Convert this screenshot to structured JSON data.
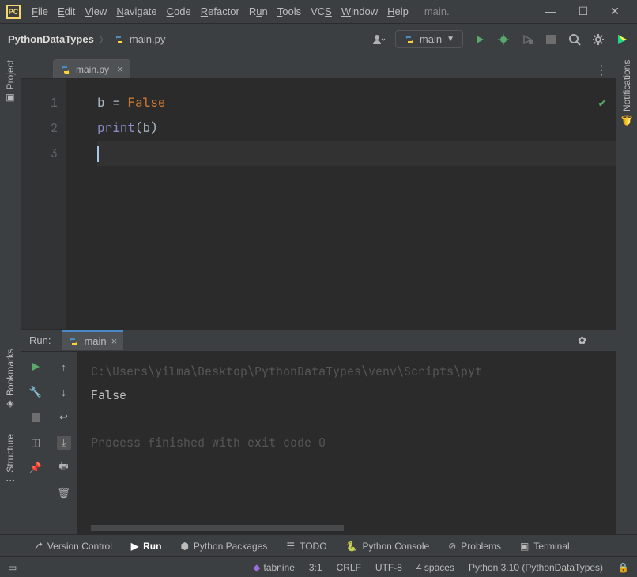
{
  "titlebar": {
    "menu": [
      "File",
      "Edit",
      "View",
      "Navigate",
      "Code",
      "Refactor",
      "Run",
      "Tools",
      "VCS",
      "Window",
      "Help"
    ],
    "title": "main."
  },
  "breadcrumb": {
    "project": "PythonDataTypes",
    "file": "main.py"
  },
  "run_config": {
    "label": "main"
  },
  "tabs": {
    "editor": "main.py"
  },
  "editor": {
    "lines": [
      "1",
      "2",
      "3"
    ],
    "code": {
      "l1_var": "b ",
      "l1_eq": "= ",
      "l1_val": "False",
      "l2_fn": "print",
      "l2_open": "(",
      "l2_arg": "b",
      "l2_close": ")"
    }
  },
  "left_rail": {
    "project": "Project",
    "bookmarks": "Bookmarks",
    "structure": "Structure"
  },
  "right_rail": {
    "notifications": "Notifications"
  },
  "run_panel": {
    "label": "Run:",
    "tab": "main",
    "cmd": "C:\\Users\\yilma\\Desktop\\PythonDataTypes\\venv\\Scripts\\pyt",
    "output": "False",
    "exit": "Process finished with exit code 0"
  },
  "bottom_tools": {
    "vcs": "Version Control",
    "run": "Run",
    "packages": "Python Packages",
    "todo": "TODO",
    "console": "Python Console",
    "problems": "Problems",
    "terminal": "Terminal"
  },
  "statusbar": {
    "tabnine": "tabnine",
    "pos": "3:1",
    "crlf": "CRLF",
    "enc": "UTF-8",
    "indent": "4 spaces",
    "interp": "Python 3.10 (PythonDataTypes)"
  }
}
